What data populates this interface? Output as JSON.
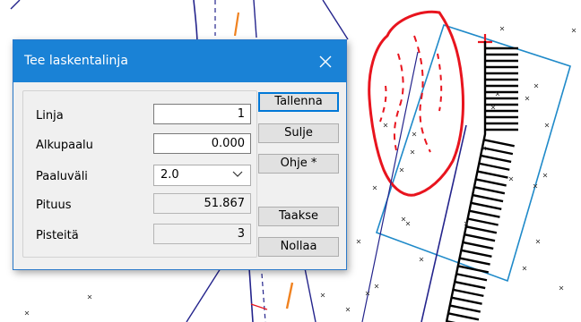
{
  "dialog": {
    "title": "Tee laskentalinja",
    "fields": {
      "linja": {
        "label": "Linja",
        "value": "1"
      },
      "alkupaalu": {
        "label": "Alkupaalu",
        "value": "0.000"
      },
      "paaluvali": {
        "label": "Paaluväli",
        "value": "2.0"
      },
      "pituus": {
        "label": "Pituus",
        "value": "51.867"
      },
      "pisteita": {
        "label": "Pisteitä",
        "value": "3"
      }
    },
    "buttons": {
      "tallenna": "Tallenna",
      "sulje": "Sulje",
      "ohje": "Ohje *",
      "taakse": "Taakse",
      "nollaa": "Nollaa"
    }
  },
  "colors": {
    "titlebar": "#1a82d6",
    "cad_red": "#e8141e",
    "cad_blue": "#1f8ac9",
    "cad_navy": "#24248c",
    "cad_orange": "#f08220"
  }
}
